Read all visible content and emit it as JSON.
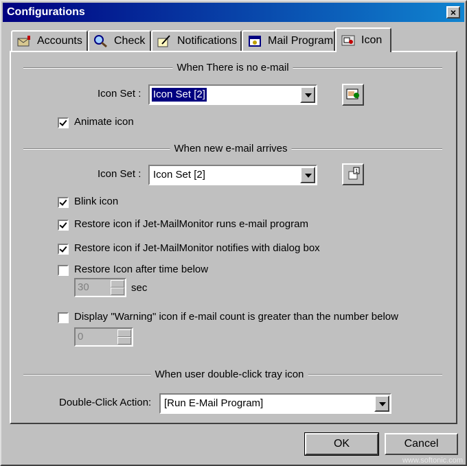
{
  "window": {
    "title": "Configurations",
    "close_glyph": "×"
  },
  "tabs": [
    {
      "label": "Accounts",
      "icon": "mailbox-icon"
    },
    {
      "label": "Check",
      "icon": "magnifier-icon"
    },
    {
      "label": "Notifications",
      "icon": "pen-paper-icon"
    },
    {
      "label": "Mail Program",
      "icon": "program-window-icon"
    },
    {
      "label": "Icon",
      "icon": "tray-icon"
    }
  ],
  "active_tab": "Icon",
  "no_email": {
    "group_title": "When There is no e-mail",
    "icon_set_label": "Icon Set :",
    "icon_set_value": "Icon Set [2]",
    "animate_label": "Animate icon",
    "animate_checked": true
  },
  "new_email": {
    "group_title": "When new e-mail arrives",
    "icon_set_label": "Icon Set :",
    "icon_set_value": "Icon Set [2]",
    "blink_label": "Blink icon",
    "blink_checked": true,
    "restore_program_label": "Restore icon if Jet-MailMonitor runs e-mail program",
    "restore_program_checked": true,
    "restore_dialog_label": "Restore icon if Jet-MailMonitor notifies with dialog box",
    "restore_dialog_checked": true,
    "restore_time_label": "Restore Icon after time below",
    "restore_time_checked": false,
    "restore_time_value": "30",
    "restore_time_unit": "sec",
    "warning_label": "Display \"Warning\" icon if e-mail count is greater than the number below",
    "warning_checked": false,
    "warning_value": "0"
  },
  "double_click": {
    "group_title": "When user double-click tray icon",
    "action_label": "Double-Click Action:",
    "action_value": "[Run E-Mail Program]"
  },
  "buttons": {
    "ok": "OK",
    "cancel": "Cancel"
  },
  "watermark": "www.softonic.com"
}
